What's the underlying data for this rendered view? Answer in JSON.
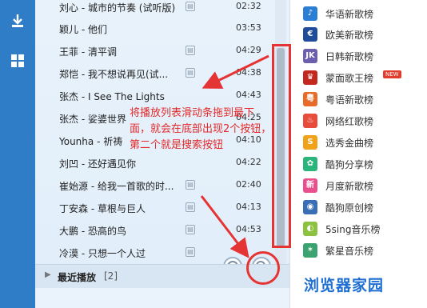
{
  "playlist": {
    "rows": [
      {
        "title": "刘心 - 城市的节奏 (试听版)",
        "duration": "02:32"
      },
      {
        "title": "颖儿 - 他们",
        "duration": "03:53"
      },
      {
        "title": "王菲 - 清平调",
        "duration": "04:29"
      },
      {
        "title": "郑恺 - 我不想说再见(试...",
        "duration": "04:38"
      },
      {
        "title": "张杰 - I See The Lights",
        "duration": "04:43"
      },
      {
        "title": "张杰 - 娑婆世界",
        "duration": "04:25"
      },
      {
        "title": "Younha - 祈祷",
        "duration": "04:10"
      },
      {
        "title": "刘凹 - 还好遇见你",
        "duration": "04:22"
      },
      {
        "title": "崔始源 - 给我一首歌的时...",
        "duration": "02:40"
      },
      {
        "title": "丁安森 - 草根与巨人",
        "duration": "04:13"
      },
      {
        "title": "大鹏 - 恐高的鸟",
        "duration": "04:53"
      },
      {
        "title": "冷漠 - 只想一个人过",
        "duration": "04:22"
      }
    ],
    "recent_label": "最近播放",
    "recent_count": "[2]"
  },
  "charts": {
    "items": [
      {
        "label": "华语新歌榜",
        "badge": "♪",
        "color": "#2a7fd4"
      },
      {
        "label": "欧美新歌榜",
        "badge": "€",
        "color": "#1f4d99"
      },
      {
        "label": "日韩新歌榜",
        "badge": "JK",
        "color": "#6d5fb0"
      },
      {
        "label": "蒙面歌王榜",
        "badge": "♛",
        "color": "#c3281e",
        "new": "NEW"
      },
      {
        "label": "粤语新歌榜",
        "badge": "粤",
        "color": "#e96b2a"
      },
      {
        "label": "网络红歌榜",
        "badge": "♨",
        "color": "#e84d3c"
      },
      {
        "label": "选秀金曲榜",
        "badge": "S",
        "color": "#f0a21b"
      },
      {
        "label": "酷狗分享榜",
        "badge": "✿",
        "color": "#2ab57d"
      },
      {
        "label": "月度新歌榜",
        "badge": "新",
        "color": "#e84f8c"
      },
      {
        "label": "酷狗原创榜",
        "badge": "◉",
        "color": "#3b6fb5"
      },
      {
        "label": "5sing音乐榜",
        "badge": "◐",
        "color": "#8cc23f"
      },
      {
        "label": "繁星音乐榜",
        "badge": "✶",
        "color": "#3aa36f"
      }
    ]
  },
  "annotation": {
    "text": "将播放列表滑动条拖到最下面，就会在底部出现2个按钮，第二个就是搜索按钮"
  },
  "watermark": "浏览器家园"
}
